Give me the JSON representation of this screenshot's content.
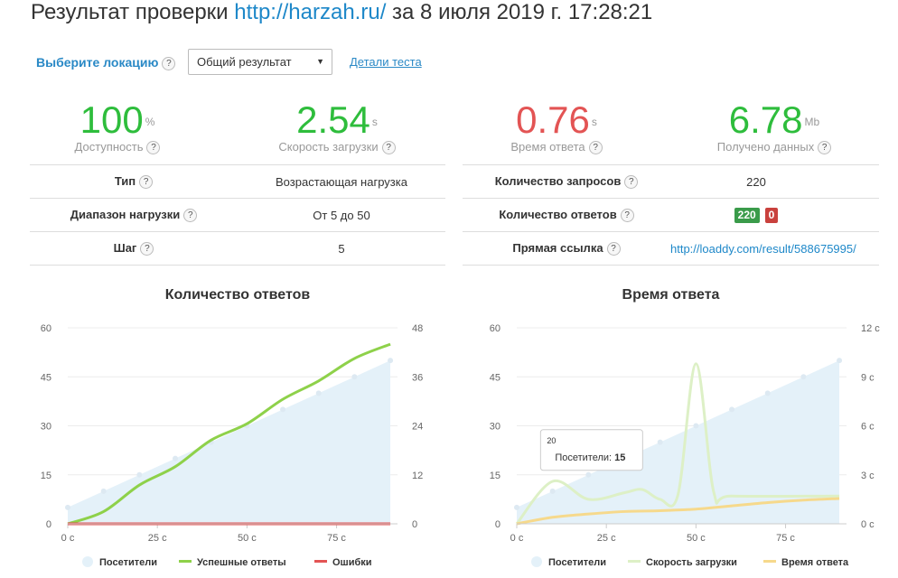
{
  "header": {
    "title_prefix": "Результат проверки",
    "url": "http://harzah.ru/",
    "title_suffix": "за 8 июля 2019 г. 17:28:21"
  },
  "location": {
    "label": "Выберите локацию",
    "selected": "Общий результат",
    "details_link": "Детали теста"
  },
  "metrics": [
    {
      "value": "100",
      "unit": "%",
      "label": "Доступность",
      "color": "#2ebd3c"
    },
    {
      "value": "2.54",
      "unit": "s",
      "label": "Скорость загрузки",
      "color": "#2ebd3c"
    },
    {
      "value": "0.76",
      "unit": "s",
      "label": "Время ответа",
      "color": "#e35454"
    },
    {
      "value": "6.78",
      "unit": "Mb",
      "label": "Получено данных",
      "color": "#2ebd3c"
    }
  ],
  "left_table": [
    {
      "key": "Тип",
      "value": "Возрастающая нагрузка"
    },
    {
      "key": "Диапазон нагрузки",
      "value": "От 5 до 50"
    },
    {
      "key": "Шаг",
      "value": "5"
    }
  ],
  "right_table": {
    "requests": {
      "key": "Количество запросов",
      "value": "220"
    },
    "responses": {
      "key": "Количество ответов",
      "ok": "220",
      "err": "0"
    },
    "link": {
      "key": "Прямая ссылка",
      "value": "http://loaddy.com/result/588675995/"
    }
  },
  "help_glyph": "?",
  "chart_data": [
    {
      "type": "line",
      "title": "Количество ответов",
      "x_ticks": [
        "0 с",
        "25 с",
        "50 с",
        "75 с"
      ],
      "x_tick_values": [
        0,
        25,
        50,
        75
      ],
      "xlim": [
        0,
        92
      ],
      "y_left_ticks": [
        "0",
        "15",
        "30",
        "45",
        "60"
      ],
      "y_left_values": [
        0,
        15,
        30,
        45,
        60
      ],
      "ylim_left": [
        0,
        60
      ],
      "y_right_ticks": [
        "0",
        "12",
        "24",
        "36",
        "48"
      ],
      "y_right_values": [
        0,
        12,
        24,
        36,
        48
      ],
      "ylim_right": [
        0,
        48
      ],
      "series": [
        {
          "name": "Посетители",
          "color": "#e4f1f9",
          "kind": "area",
          "axis": "left",
          "x": [
            0,
            10,
            20,
            30,
            40,
            50,
            60,
            70,
            80,
            90
          ],
          "values": [
            5,
            10,
            15,
            20,
            25,
            30,
            35,
            40,
            45,
            50
          ]
        },
        {
          "name": "Успешные ответы",
          "color": "#8ed14a",
          "kind": "line",
          "axis": "right",
          "x": [
            0,
            10,
            20,
            30,
            40,
            50,
            60,
            70,
            80,
            90
          ],
          "values": [
            0,
            3,
            9.5,
            14,
            20.5,
            24.5,
            30.5,
            35,
            40.5,
            44
          ]
        },
        {
          "name": "Ошибки",
          "color": "#e35454",
          "kind": "line",
          "axis": "right",
          "x": [
            0,
            90
          ],
          "values": [
            0,
            0
          ]
        }
      ]
    },
    {
      "type": "line",
      "title": "Время ответа",
      "x_ticks": [
        "0 с",
        "25 с",
        "50 с",
        "75 с"
      ],
      "x_tick_values": [
        0,
        25,
        50,
        75
      ],
      "xlim": [
        0,
        92
      ],
      "y_left_ticks": [
        "0",
        "15",
        "30",
        "45",
        "60"
      ],
      "y_left_values": [
        0,
        15,
        30,
        45,
        60
      ],
      "ylim_left": [
        0,
        60
      ],
      "y_right_ticks": [
        "0 с",
        "3 с",
        "6 с",
        "9 с",
        "12 с"
      ],
      "y_right_values": [
        0,
        3,
        6,
        9,
        12
      ],
      "ylim_right": [
        0,
        12
      ],
      "series": [
        {
          "name": "Посетители",
          "color": "#e4f1f9",
          "kind": "area",
          "axis": "left",
          "x": [
            0,
            10,
            20,
            30,
            40,
            50,
            60,
            70,
            80,
            90
          ],
          "values": [
            5,
            10,
            15,
            20,
            25,
            30,
            35,
            40,
            45,
            50
          ]
        },
        {
          "name": "Скорость загрузки",
          "color": "#ddf0c6",
          "kind": "line",
          "axis": "right",
          "x": [
            0,
            10,
            20,
            30,
            35,
            40,
            45,
            50,
            55,
            60,
            90
          ],
          "values": [
            0,
            2.6,
            1.5,
            1.9,
            2.1,
            1.5,
            1.8,
            9.8,
            1.9,
            1.7,
            1.7
          ]
        },
        {
          "name": "Время ответа",
          "color": "#f6d98c",
          "kind": "line",
          "axis": "right",
          "x": [
            0,
            10,
            20,
            30,
            40,
            50,
            60,
            70,
            80,
            90
          ],
          "values": [
            0,
            0.4,
            0.6,
            0.75,
            0.8,
            0.9,
            1.1,
            1.3,
            1.45,
            1.55
          ]
        }
      ],
      "tooltip": {
        "x_label": "20",
        "series": "Посетители",
        "value": "15"
      }
    }
  ]
}
